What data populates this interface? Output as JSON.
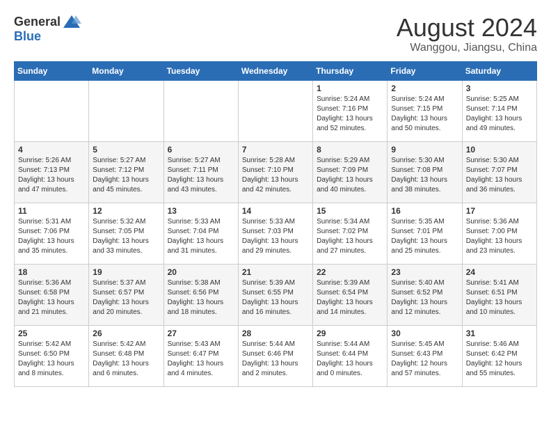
{
  "logo": {
    "general": "General",
    "blue": "Blue"
  },
  "header": {
    "month": "August 2024",
    "location": "Wanggou, Jiangsu, China"
  },
  "weekdays": [
    "Sunday",
    "Monday",
    "Tuesday",
    "Wednesday",
    "Thursday",
    "Friday",
    "Saturday"
  ],
  "weeks": [
    [
      {
        "day": "",
        "info": ""
      },
      {
        "day": "",
        "info": ""
      },
      {
        "day": "",
        "info": ""
      },
      {
        "day": "",
        "info": ""
      },
      {
        "day": "1",
        "info": "Sunrise: 5:24 AM\nSunset: 7:16 PM\nDaylight: 13 hours\nand 52 minutes."
      },
      {
        "day": "2",
        "info": "Sunrise: 5:24 AM\nSunset: 7:15 PM\nDaylight: 13 hours\nand 50 minutes."
      },
      {
        "day": "3",
        "info": "Sunrise: 5:25 AM\nSunset: 7:14 PM\nDaylight: 13 hours\nand 49 minutes."
      }
    ],
    [
      {
        "day": "4",
        "info": "Sunrise: 5:26 AM\nSunset: 7:13 PM\nDaylight: 13 hours\nand 47 minutes."
      },
      {
        "day": "5",
        "info": "Sunrise: 5:27 AM\nSunset: 7:12 PM\nDaylight: 13 hours\nand 45 minutes."
      },
      {
        "day": "6",
        "info": "Sunrise: 5:27 AM\nSunset: 7:11 PM\nDaylight: 13 hours\nand 43 minutes."
      },
      {
        "day": "7",
        "info": "Sunrise: 5:28 AM\nSunset: 7:10 PM\nDaylight: 13 hours\nand 42 minutes."
      },
      {
        "day": "8",
        "info": "Sunrise: 5:29 AM\nSunset: 7:09 PM\nDaylight: 13 hours\nand 40 minutes."
      },
      {
        "day": "9",
        "info": "Sunrise: 5:30 AM\nSunset: 7:08 PM\nDaylight: 13 hours\nand 38 minutes."
      },
      {
        "day": "10",
        "info": "Sunrise: 5:30 AM\nSunset: 7:07 PM\nDaylight: 13 hours\nand 36 minutes."
      }
    ],
    [
      {
        "day": "11",
        "info": "Sunrise: 5:31 AM\nSunset: 7:06 PM\nDaylight: 13 hours\nand 35 minutes."
      },
      {
        "day": "12",
        "info": "Sunrise: 5:32 AM\nSunset: 7:05 PM\nDaylight: 13 hours\nand 33 minutes."
      },
      {
        "day": "13",
        "info": "Sunrise: 5:33 AM\nSunset: 7:04 PM\nDaylight: 13 hours\nand 31 minutes."
      },
      {
        "day": "14",
        "info": "Sunrise: 5:33 AM\nSunset: 7:03 PM\nDaylight: 13 hours\nand 29 minutes."
      },
      {
        "day": "15",
        "info": "Sunrise: 5:34 AM\nSunset: 7:02 PM\nDaylight: 13 hours\nand 27 minutes."
      },
      {
        "day": "16",
        "info": "Sunrise: 5:35 AM\nSunset: 7:01 PM\nDaylight: 13 hours\nand 25 minutes."
      },
      {
        "day": "17",
        "info": "Sunrise: 5:36 AM\nSunset: 7:00 PM\nDaylight: 13 hours\nand 23 minutes."
      }
    ],
    [
      {
        "day": "18",
        "info": "Sunrise: 5:36 AM\nSunset: 6:58 PM\nDaylight: 13 hours\nand 21 minutes."
      },
      {
        "day": "19",
        "info": "Sunrise: 5:37 AM\nSunset: 6:57 PM\nDaylight: 13 hours\nand 20 minutes."
      },
      {
        "day": "20",
        "info": "Sunrise: 5:38 AM\nSunset: 6:56 PM\nDaylight: 13 hours\nand 18 minutes."
      },
      {
        "day": "21",
        "info": "Sunrise: 5:39 AM\nSunset: 6:55 PM\nDaylight: 13 hours\nand 16 minutes."
      },
      {
        "day": "22",
        "info": "Sunrise: 5:39 AM\nSunset: 6:54 PM\nDaylight: 13 hours\nand 14 minutes."
      },
      {
        "day": "23",
        "info": "Sunrise: 5:40 AM\nSunset: 6:52 PM\nDaylight: 13 hours\nand 12 minutes."
      },
      {
        "day": "24",
        "info": "Sunrise: 5:41 AM\nSunset: 6:51 PM\nDaylight: 13 hours\nand 10 minutes."
      }
    ],
    [
      {
        "day": "25",
        "info": "Sunrise: 5:42 AM\nSunset: 6:50 PM\nDaylight: 13 hours\nand 8 minutes."
      },
      {
        "day": "26",
        "info": "Sunrise: 5:42 AM\nSunset: 6:48 PM\nDaylight: 13 hours\nand 6 minutes."
      },
      {
        "day": "27",
        "info": "Sunrise: 5:43 AM\nSunset: 6:47 PM\nDaylight: 13 hours\nand 4 minutes."
      },
      {
        "day": "28",
        "info": "Sunrise: 5:44 AM\nSunset: 6:46 PM\nDaylight: 13 hours\nand 2 minutes."
      },
      {
        "day": "29",
        "info": "Sunrise: 5:44 AM\nSunset: 6:44 PM\nDaylight: 13 hours\nand 0 minutes."
      },
      {
        "day": "30",
        "info": "Sunrise: 5:45 AM\nSunset: 6:43 PM\nDaylight: 12 hours\nand 57 minutes."
      },
      {
        "day": "31",
        "info": "Sunrise: 5:46 AM\nSunset: 6:42 PM\nDaylight: 12 hours\nand 55 minutes."
      }
    ]
  ]
}
